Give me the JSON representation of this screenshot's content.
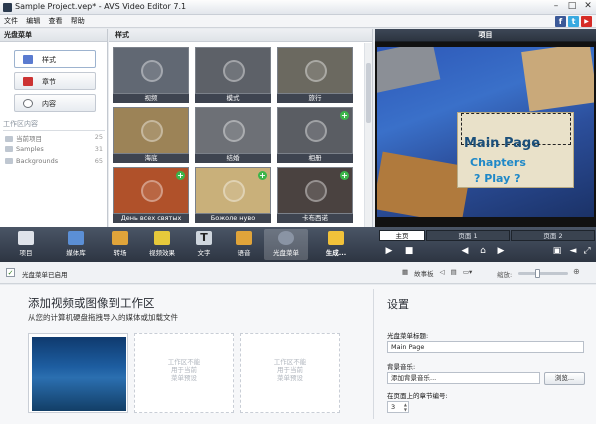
{
  "window": {
    "title": "Sample Project.vep* - AVS Video Editor 7.1"
  },
  "menu": [
    "文件",
    "编辑",
    "查看",
    "帮助"
  ],
  "social": {
    "facebook": "f",
    "twitter": "t",
    "youtube": "▶"
  },
  "disc_menu_panel": {
    "title": "光盘菜单",
    "buttons": [
      {
        "label": "样式",
        "color": "#5a7bd0"
      },
      {
        "label": "章节",
        "color": "#cc3333"
      },
      {
        "label": "内容",
        "color": "#6b6f75"
      }
    ],
    "workspace_title": "工作区内容",
    "workspace_items": [
      {
        "label": "当前项目",
        "count": "25"
      },
      {
        "label": "Samples",
        "count": "31"
      },
      {
        "label": "Backgrounds",
        "count": "65"
      }
    ]
  },
  "styles_panel": {
    "title": "样式",
    "thumbs": [
      {
        "label": "视频",
        "plus": false,
        "color": "#616873"
      },
      {
        "label": "模式",
        "plus": false,
        "color": "#5d6168"
      },
      {
        "label": "旅行",
        "plus": false,
        "color": "#6b6960"
      },
      {
        "label": "海底",
        "plus": false,
        "color": "#9c8357"
      },
      {
        "label": "结婚",
        "plus": false,
        "color": "#6d7076"
      },
      {
        "label": "相册",
        "plus": true,
        "color": "#5a5d63"
      },
      {
        "label": "День всех святых",
        "plus": true,
        "color": "#b0512a"
      },
      {
        "label": "Божоле нуво",
        "plus": true,
        "color": "#c9b07a"
      },
      {
        "label": "卡布西诺",
        "plus": true,
        "color": "#4a4240"
      }
    ]
  },
  "preview": {
    "title": "项目",
    "menu_title": "Main Page",
    "menu_item1": "Chapters",
    "menu_item2": "? Play ?",
    "page_tabs": [
      "主页",
      "页面 1",
      "页面 2"
    ]
  },
  "toolbar": {
    "buttons": [
      {
        "label": "项目",
        "color": "#dfe3ea"
      },
      {
        "label": "媒体库",
        "color": "#5b8fd6"
      },
      {
        "label": "转场",
        "color": "#e0a43a"
      },
      {
        "label": "视频效果",
        "color": "#e6c93b"
      },
      {
        "label": "文字",
        "color": "#cfd6de"
      },
      {
        "label": "语音",
        "color": "#e0a43a"
      },
      {
        "label": "光盘菜单",
        "color": "#8a94a4"
      },
      {
        "label": "生成...",
        "color": "#f1c23a"
      }
    ]
  },
  "subbar": {
    "checkbox_label": "光盘菜单已启用",
    "checked": true,
    "storyboard_label": "故事板",
    "zoom_label": "缩放:"
  },
  "add_area": {
    "title": "添加视频或图像到工作区",
    "subtitle": "从您的计算机硬盘拖拽导入的媒体或加载文件",
    "slot_text": [
      "工作区不能",
      "用于当前",
      "菜单预设"
    ]
  },
  "settings": {
    "title": "设置",
    "menu_title_label": "光盘菜单标题:",
    "menu_title_value": "Main Page",
    "bg_music_label": "背景音乐:",
    "bg_music_placeholder": "添加背景音乐...",
    "browse_label": "浏览...",
    "chapters_label": "在页面上的章节编号:",
    "chapters_value": "3"
  }
}
